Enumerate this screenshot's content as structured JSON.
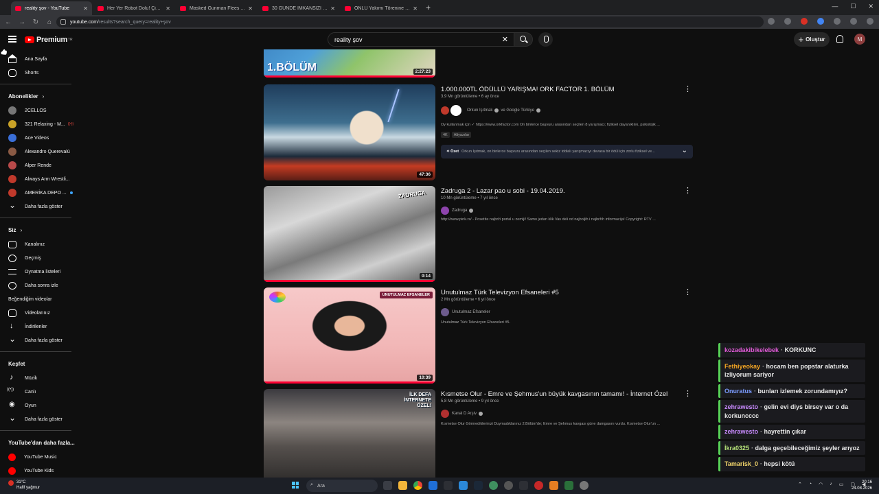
{
  "browser": {
    "tabs": [
      {
        "title": "reality şov - YouTube",
        "active": true
      },
      {
        "title": "Her Yer Robot Dolu! Çin'de Bir...",
        "active": false
      },
      {
        "title": "Masked Gunman Flees After B...",
        "active": false
      },
      {
        "title": "30 GÜNDE İMKANSIZI BAŞARA...",
        "active": false
      },
      {
        "title": "ÖNLÜ Yakımı Törenine Katıldım",
        "active": false
      }
    ],
    "url_host": "youtube.com",
    "url_path": "/results?search_query=reality+şov"
  },
  "header": {
    "logo_text": "Premium",
    "logo_sup": "TR",
    "search_value": "reality şov",
    "create_label": "Oluştur",
    "avatar_letter": "M"
  },
  "sidebar": {
    "main": [
      {
        "label": "Ana Sayfa",
        "icon": "home-icon"
      },
      {
        "label": "Shorts",
        "icon": "shorts-icon"
      }
    ],
    "subs_heading": "Abonelikler",
    "subs": [
      {
        "label": "2CELLOS",
        "color": "#777777",
        "dot": ""
      },
      {
        "label": "321 Relaxing - M...",
        "color": "#c9a227",
        "dot": "live"
      },
      {
        "label": "Ace Videos",
        "color": "#3a6fd8",
        "dot": ""
      },
      {
        "label": "Alexandro Querevalú",
        "color": "#8a5a44",
        "dot": ""
      },
      {
        "label": "Alper Rende",
        "color": "#b84a4a",
        "dot": ""
      },
      {
        "label": "Always Arm Wrestli...",
        "color": "#c0392b",
        "dot": ""
      },
      {
        "label": "AMERİKA DEPO ...",
        "color": "#c0392b",
        "dot": "new"
      }
    ],
    "subs_more": "Daha fazla göster",
    "you_heading": "Siz",
    "you": [
      {
        "label": "Kanalınız",
        "icon": "channel-icon"
      },
      {
        "label": "Geçmiş",
        "icon": "history-icon"
      },
      {
        "label": "Oynatma listeleri",
        "icon": "playlists-icon"
      },
      {
        "label": "Daha sonra izle",
        "icon": "watch-later-icon"
      },
      {
        "label": "Beğendiğim videolar",
        "icon": "liked-icon"
      },
      {
        "label": "Videolarınız",
        "icon": "your-videos-icon"
      },
      {
        "label": "İndirilenler",
        "icon": "downloads-icon"
      },
      {
        "label": "Daha fazla göster",
        "icon": "chevron-down-icon"
      }
    ],
    "explore_heading": "Keşfet",
    "explore": [
      {
        "label": "Müzik",
        "icon": "music-icon"
      },
      {
        "label": "Canlı",
        "icon": "live-icon"
      },
      {
        "label": "Oyun",
        "icon": "gaming-icon"
      },
      {
        "label": "Daha fazla göster",
        "icon": "chevron-down-icon"
      }
    ],
    "more_heading": "YouTube'dan daha fazla...",
    "more": [
      {
        "label": "YouTube Music"
      },
      {
        "label": "YouTube Kids"
      }
    ]
  },
  "results": {
    "partial_top": {
      "title_overlay": "1.BÖLÜM",
      "duration": "2:27:23"
    },
    "videos": [
      {
        "title": "1.000.000TL ÖDÜLLÜ YARIŞMA! ORK FACTOR 1. BÖLÜM",
        "meta": "3,9 Mn görüntüleme • 6 ay önce",
        "channel": "Orkun Işıtmak",
        "channel_extra": "ve Google Türkiye",
        "desc": "Oy kullanmak için ✓ https://www.orkfactor.com On binlerce başvuru arasından seçilen 8 yarışmacı; fiziksel dayanıklılık, psikolojik ...",
        "badges": [
          "4K",
          "Altyazılar"
        ],
        "summary_label": "Özet",
        "summary_text": "Orkun Işıtmak, on binlerce başvuru arasından seçilen sekiz iddialı yarışmacıyı devasa bir ödül için zorlu fiziksel ve...",
        "duration": "47:36"
      },
      {
        "title": "Zadruga 2 - Lazar pao u sobi - 19.04.2019.",
        "meta": "10 Mn görüntüleme • 7 yıl önce",
        "channel": "Zadruga",
        "desc": "http://www.pink.rs/ - Posetite najbrži portal u zemlji! Samo jedan klik Vas deli od najbolјih i najbržih informacija! Copyright: RTV ...",
        "duration": "0:14",
        "thumb_label": "ZADRUGA"
      },
      {
        "title": "Unutulmaz Türk Televizyon Efsaneleri #5",
        "meta": "2 Mn görüntüleme • 6 yıl önce",
        "channel": "Unutulmaz Efsaneler",
        "desc": "Unutulmaz Türk Televizyon Efsaneleri #5.",
        "duration": "10:39",
        "thumb_label": "UNUTULMAZ EFSANELER"
      },
      {
        "title": "Kısmetse Olur - Emre ve Şehmus'un büyük kavgasının tamamı! - İnternet Özel",
        "meta": "5,8 Mn görüntüleme • 9 yıl önce",
        "channel": "Kanal D Arşiv",
        "desc": "Kısmetse Olur Görmediklerinizi Duymadıklarınız 2.Bölüm'de; Emre ve Şehmus kavgası güne damgasını vurdu. Kısmetse Olur'un ...",
        "thumb_label": "İLK DEFA İNTERNETE ÖZEL!"
      }
    ]
  },
  "chat": [
    {
      "user": "kozadakibikelebek",
      "text": "KORKUNC",
      "color": "#e25bd8"
    },
    {
      "user": "Fethiyeokay",
      "text": "hocam ben popstar alaturka izliyorum sariyor",
      "color": "#f5a623"
    },
    {
      "user": "Onuratus",
      "text": "bunları izlemek zorundamıyız?",
      "color": "#7b9cff"
    },
    {
      "user": "zehrawesto",
      "text": "gelin evi diys birsey var o da korkuncccc",
      "color": "#c98bff"
    },
    {
      "user": "zehrawesto",
      "text": "hayrettin çıkar",
      "color": "#c98bff"
    },
    {
      "user": "İkra0325",
      "text": "dalga geçebileceğimiz şeyler arıyoz",
      "color": "#b7e37a"
    },
    {
      "user": "Tamarisk_0",
      "text": "hepsi kötü",
      "color": "#f1d46b"
    }
  ],
  "taskbar": {
    "temp": "31°C",
    "weather": "Hafif yağmur",
    "search_placeholder": "Ara",
    "time": "20:16",
    "date": "24.08.2026"
  }
}
